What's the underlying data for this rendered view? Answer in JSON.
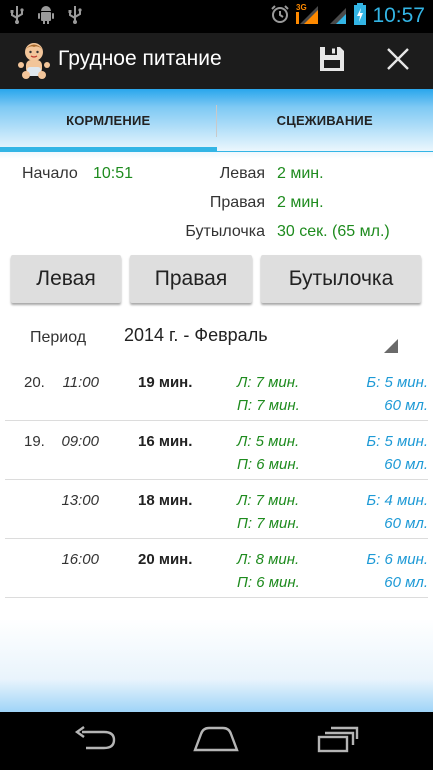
{
  "status_bar": {
    "time": "10:57",
    "network": "3G",
    "icons": [
      "usb-icon",
      "android-debug-icon",
      "usb-icon",
      "alarm-icon",
      "signal-icon",
      "battery-icon"
    ]
  },
  "action_bar": {
    "title": "Грудное питание",
    "app_icon": "baby-icon",
    "save_icon": "save-icon",
    "close_icon": "close-icon"
  },
  "tabs": [
    {
      "label": "КОРМЛЕНИЕ",
      "active": true
    },
    {
      "label": "СЦЕЖИВАНИЕ",
      "active": false
    }
  ],
  "summary": {
    "start_label": "Начало",
    "start_value": "10:51",
    "left_label": "Левая",
    "left_value": "2 мин.",
    "right_label": "Правая",
    "right_value": "2 мин.",
    "bottle_label": "Бутылочка",
    "bottle_value": "30 сек. (65 мл.)"
  },
  "buttons": {
    "left": "Левая",
    "right": "Правая",
    "bottle": "Бутылочка"
  },
  "period": {
    "label": "Период",
    "value": "2014 г. - Февраль"
  },
  "entries": [
    {
      "day": "20.",
      "time": "11:00",
      "duration": "19 мин.",
      "left": "Л: 7 мин.",
      "right": "П: 7 мин.",
      "bottle": "Б: 5 мин.",
      "ml": "60 мл."
    },
    {
      "day": "19.",
      "time": "09:00",
      "duration": "16 мин.",
      "left": "Л: 5 мин.",
      "right": "П: 6 мин.",
      "bottle": "Б: 5 мин.",
      "ml": "60 мл."
    },
    {
      "day": "",
      "time": "13:00",
      "duration": "18 мин.",
      "left": "Л: 7 мин.",
      "right": "П: 7 мин.",
      "bottle": "Б: 4 мин.",
      "ml": "60 мл."
    },
    {
      "day": "",
      "time": "16:00",
      "duration": "20 мин.",
      "left": "Л: 8 мин.",
      "right": "П: 6 мин.",
      "bottle": "Б: 6 мин.",
      "ml": "60 мл."
    }
  ],
  "colors": {
    "accent": "#33b5e5",
    "green_text": "#1e8b1e",
    "blue_text": "#1e9ad6"
  },
  "nav_bar": {
    "icons": [
      "back-icon",
      "home-icon",
      "recent-apps-icon"
    ]
  }
}
